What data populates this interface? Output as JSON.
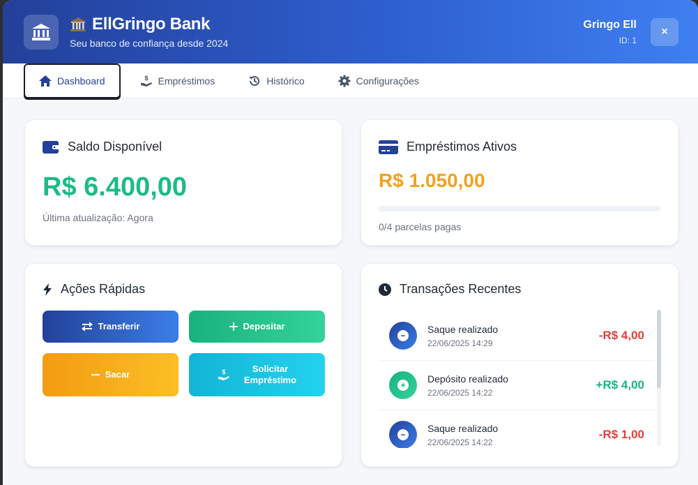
{
  "header": {
    "logo_icon": "bank-icon",
    "emoji": "🏦",
    "title": "EllGringo Bank",
    "subtitle": "Seu banco de confiança desde 2024",
    "user_name": "Gringo Ell",
    "user_id": "ID: 1",
    "close_label": "×"
  },
  "tabs": [
    {
      "label": "Dashboard",
      "icon": "home-icon",
      "active": true
    },
    {
      "label": "Empréstimos",
      "icon": "hand-dollar-icon",
      "active": false
    },
    {
      "label": "Histórico",
      "icon": "history-icon",
      "active": false
    },
    {
      "label": "Configurações",
      "icon": "gear-icon",
      "active": false
    }
  ],
  "balance_card": {
    "title": "Saldo Disponível",
    "amount": "R$ 6.400,00",
    "updated": "Última atualização: Agora"
  },
  "loans_card": {
    "title": "Empréstimos Ativos",
    "amount": "R$ 1.050,00",
    "progress_fraction": 0,
    "installments": "0/4 parcelas pagas"
  },
  "actions_card": {
    "title": "Ações Rápidas",
    "transfer": "Transferir",
    "deposit": "Depositar",
    "withdraw": "Sacar",
    "loan_line1": "Solicitar",
    "loan_line2": "Empréstimo"
  },
  "transactions_card": {
    "title": "Transações Recentes",
    "items": [
      {
        "desc": "Saque realizado",
        "date": "22/06/2025 14:29",
        "amount": "-R$ 4,00",
        "type": "withdraw"
      },
      {
        "desc": "Depósito realizado",
        "date": "22/06/2025 14:22",
        "amount": "+R$ 4,00",
        "type": "deposit"
      },
      {
        "desc": "Saque realizado",
        "date": "22/06/2025 14:22",
        "amount": "-R$ 1,00",
        "type": "withdraw"
      }
    ]
  },
  "colors": {
    "primary": "#23409a",
    "positive": "#1dbb85",
    "negative": "#e53e3e",
    "warning": "#f3a21c"
  }
}
